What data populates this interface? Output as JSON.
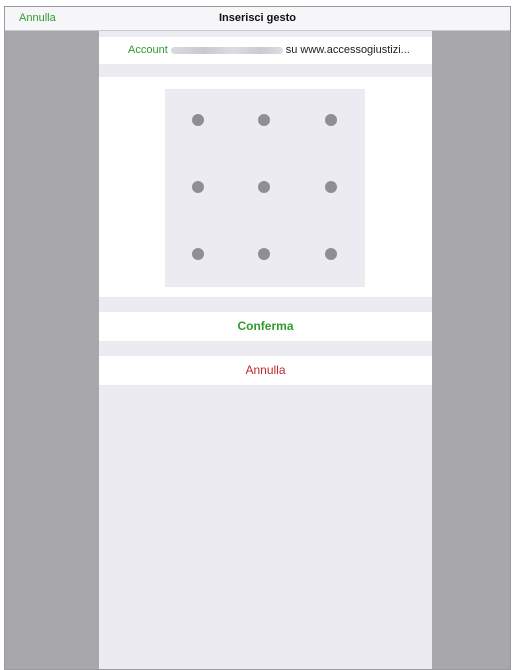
{
  "navbar": {
    "cancel_label": "Annulla",
    "title": "Inserisci gesto"
  },
  "account": {
    "prefix": "Account",
    "suffix": "su www.accessogiustizi..."
  },
  "gesture_pad": {
    "dots": 9
  },
  "actions": {
    "confirm_label": "Conferma",
    "cancel_label": "Annulla"
  },
  "colors": {
    "accent_green": "#2e9b2e",
    "destructive_red": "#c0282d",
    "dot_gray": "#8e8e93"
  }
}
